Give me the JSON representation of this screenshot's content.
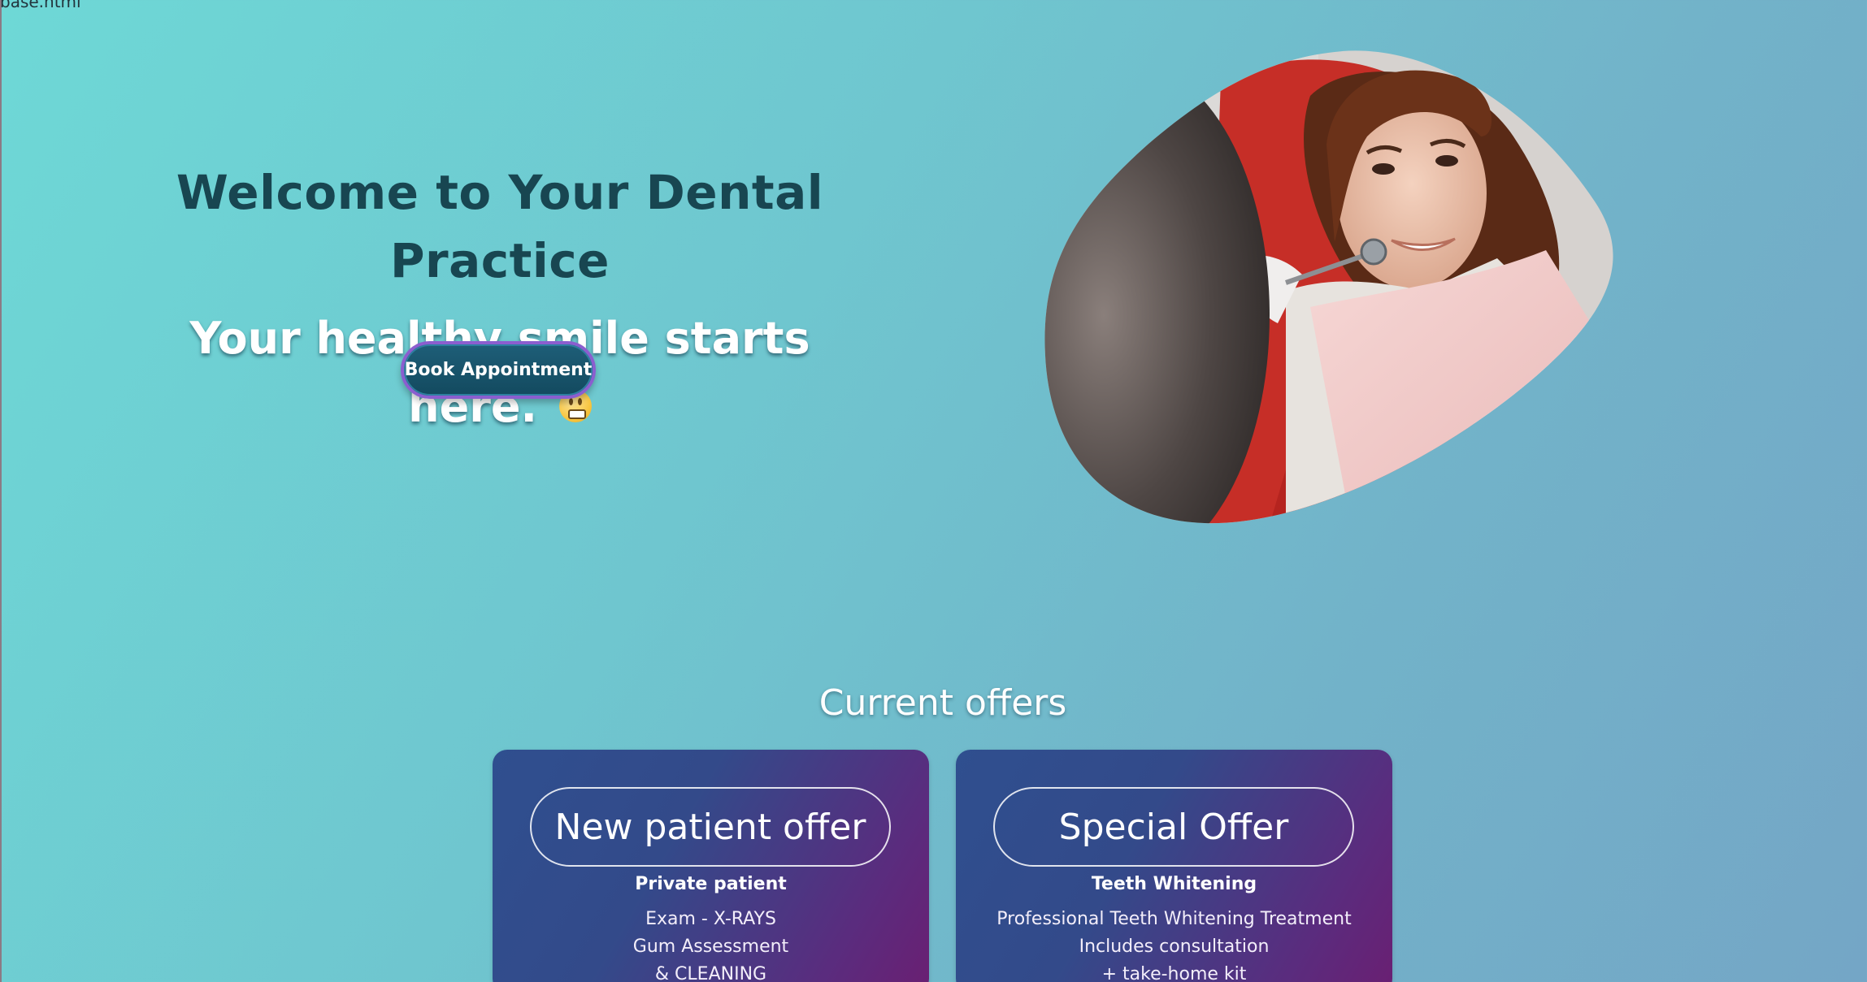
{
  "browser": {
    "tab_fragment": "base.html"
  },
  "hero": {
    "title": "Welcome to Your Dental Practice",
    "subtitle": "Your healthy smile starts here.",
    "subtitle_emoji": "grimacing-face-icon",
    "cta_label": "Book Appointment",
    "photo": "patient-at-dentist-photo"
  },
  "offers": {
    "heading": "Current offers",
    "cards": [
      {
        "title": "New patient offer",
        "subtitle": "Private patient",
        "lines": [
          "Exam - X-RAYS",
          "Gum Assessment",
          "& CLEANING"
        ]
      },
      {
        "title": "Special Offer",
        "subtitle": "Teeth Whitening",
        "lines": [
          "Professional Teeth Whitening Treatment",
          "Includes consultation",
          "+ take-home kit"
        ]
      }
    ]
  },
  "colors": {
    "background_start": "#6ed8d6",
    "background_end": "#74a6c6",
    "title_color": "#184651",
    "button_fill": "#134a5f",
    "button_border": "#8b5ecf",
    "card_gradient_start": "#2f4f8f",
    "card_gradient_end": "#6a1f72"
  }
}
